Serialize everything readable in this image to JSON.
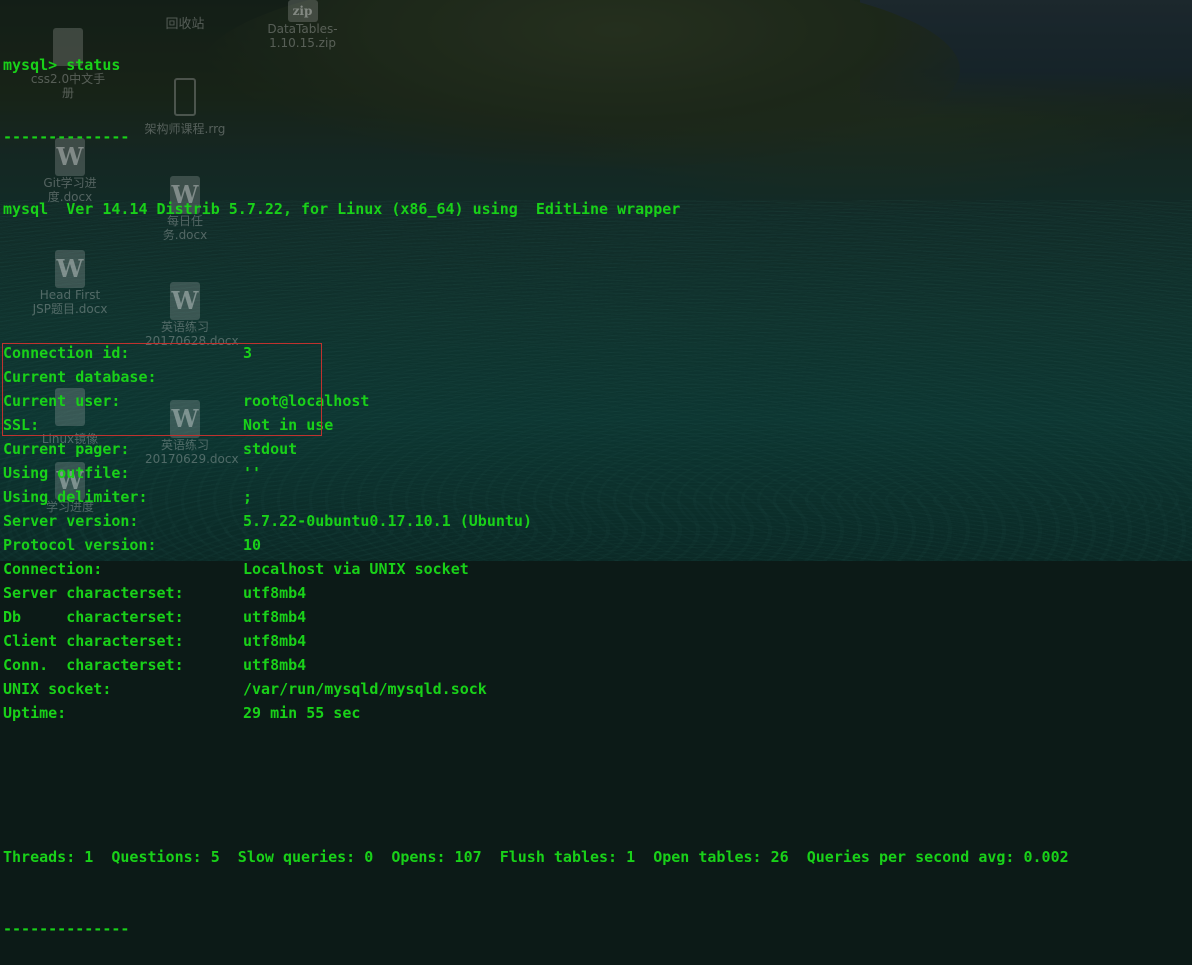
{
  "desktop_icons": [
    {
      "label": "回收站"
    },
    {
      "label": "DataTables-1.10.15.zip"
    },
    {
      "label": "css2.0中文手册"
    },
    {
      "label": "架构师课程.rrg"
    },
    {
      "label": "Git学习进度.docx"
    },
    {
      "label": "每日任务.docx"
    },
    {
      "label": "Head First JSP题目.docx"
    },
    {
      "label": "英语练习20170628.docx"
    },
    {
      "label": "Linux镜像"
    },
    {
      "label": "英语练习20170629.docx"
    },
    {
      "label": "学习进度"
    }
  ],
  "terminal": {
    "prompt": "mysql> status",
    "separator": "--------------",
    "version_line": "mysql  Ver 14.14 Distrib 5.7.22, for Linux (x86_64) using  EditLine wrapper",
    "fields": [
      {
        "label": "Connection id:",
        "value": "3"
      },
      {
        "label": "Current database:",
        "value": ""
      },
      {
        "label": "Current user:",
        "value": "root@localhost"
      },
      {
        "label": "SSL:",
        "value": "Not in use"
      },
      {
        "label": "Current pager:",
        "value": "stdout"
      },
      {
        "label": "Using outfile:",
        "value": "''"
      },
      {
        "label": "Using delimiter:",
        "value": ";"
      },
      {
        "label": "Server version:",
        "value": "5.7.22-0ubuntu0.17.10.1 (Ubuntu)"
      },
      {
        "label": "Protocol version:",
        "value": "10"
      },
      {
        "label": "Connection:",
        "value": "Localhost via UNIX socket"
      },
      {
        "label": "Server characterset:",
        "value": "utf8mb4"
      },
      {
        "label": "Db     characterset:",
        "value": "utf8mb4"
      },
      {
        "label": "Client characterset:",
        "value": "utf8mb4"
      },
      {
        "label": "Conn.  characterset:",
        "value": "utf8mb4"
      },
      {
        "label": "UNIX socket:",
        "value": "/var/run/mysqld/mysqld.sock"
      },
      {
        "label": "Uptime:",
        "value": "29 min 55 sec"
      }
    ],
    "stats_line": "Threads: 1  Questions: 5  Slow queries: 0  Opens: 107  Flush tables: 1  Open tables: 26  Queries per second avg: 0.002",
    "end_separator": "--------------",
    "text_color": "#19d119",
    "highlight_color": "#c0322e"
  }
}
